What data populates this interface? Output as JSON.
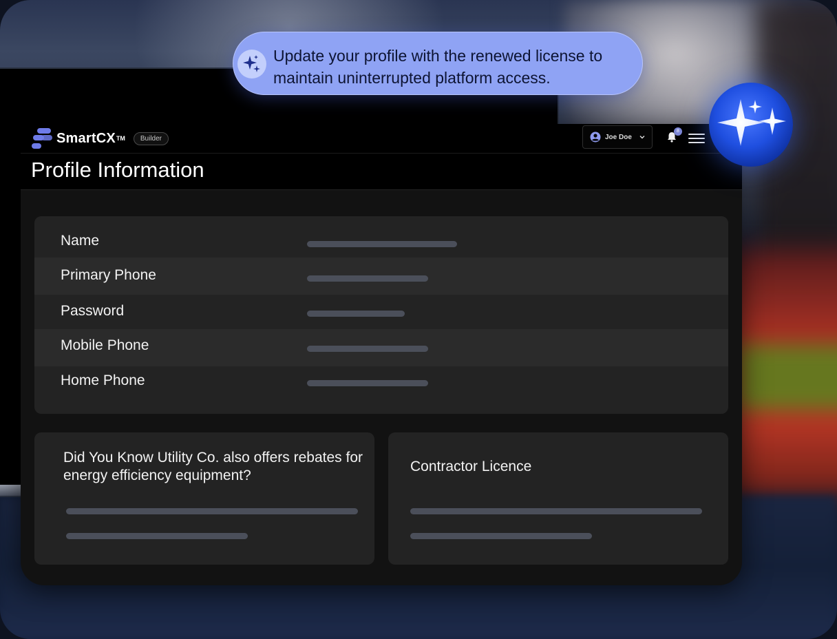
{
  "brand": {
    "name": "SmartCX",
    "trademark": "TM",
    "badge": "Builder",
    "accent": "#6e7be8"
  },
  "user_menu": {
    "name": "Joe Doe"
  },
  "notifications": {
    "count": "8"
  },
  "page": {
    "title": "Profile Information"
  },
  "profile_fields": [
    {
      "label": "Name"
    },
    {
      "label": "Primary Phone"
    },
    {
      "label": "Password"
    },
    {
      "label": "Mobile Phone"
    },
    {
      "label": "Home Phone"
    }
  ],
  "cards": {
    "rebates": {
      "text": "Did You Know Utility Co. also offers rebates for energy efficiency equipment?"
    },
    "licence": {
      "title": "Contractor Licence"
    }
  },
  "assistant": {
    "message": "Update your profile with the renewed license to maintain uninterrupted platform access.",
    "accent": "#8fa3f4",
    "orb_color": "#1f4fe0"
  },
  "icons": {
    "logo": "smartcx-logo-icon",
    "avatar": "user-avatar-icon",
    "chevron": "chevron-down-icon",
    "bell": "bell-icon",
    "menu": "hamburger-menu-icon",
    "sparkle": "sparkle-icon"
  }
}
